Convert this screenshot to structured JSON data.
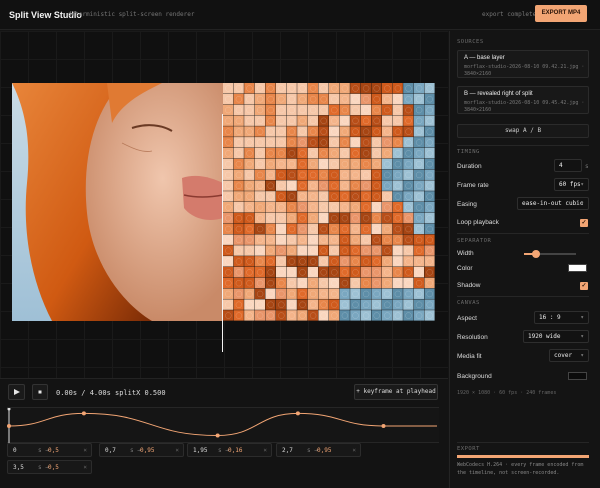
{
  "header": {
    "title": "Split View Studio",
    "subtitle": "deterministic split-screen renderer",
    "status": "export complete",
    "export_label": "EXPORT MP4"
  },
  "stage": {
    "image_description": "Portrait of a woman with orange hair, left half photo, right half pixel blocks"
  },
  "transport": {
    "play_icon": "play-icon",
    "stop_icon": "stop-icon",
    "time_readout": "0.00s / 4.00s splitX 0.500",
    "keyframe_button": "+ keyframe at playhead",
    "keyframes": [
      {
        "time": "0",
        "value": "0,5"
      },
      {
        "time": "0,7",
        "value": "0,95"
      },
      {
        "time": "1,95",
        "value": "0,16"
      },
      {
        "time": "2,7",
        "value": "0,95"
      },
      {
        "time": "3,5",
        "value": "0,5"
      }
    ],
    "keyframe_sep": "s →",
    "remove_glyph": "×"
  },
  "sidebar": {
    "sources_heading": "SOURCES",
    "source_a": {
      "title": "A — base layer",
      "meta": "morflax-studio-2026-08-10 09.42.21.jpg · 3840×2160"
    },
    "source_b": {
      "title": "B — revealed right of split",
      "meta": "morflax-studio-2026-08-10 09.45.42.jpg · 3840×2160"
    },
    "swap_label": "swap A / B",
    "timing_heading": "TIMING",
    "duration_label": "Duration",
    "duration_value": "4",
    "duration_unit": "s",
    "framerate_label": "Frame rate",
    "framerate_value": "60 fps",
    "easing_label": "Easing",
    "easing_value": "ease-in-out cubic",
    "loop_label": "Loop playback",
    "separator_heading": "SEPARATOR",
    "width_label": "Width",
    "width_fraction": 0.23,
    "color_label": "Color",
    "color_value": "#ffffff",
    "shadow_label": "Shadow",
    "canvas_heading": "CANVAS",
    "aspect_label": "Aspect",
    "aspect_value": "16 : 9",
    "resolution_label": "Resolution",
    "resolution_value": "1920 wide",
    "mediafit_label": "Media fit",
    "mediafit_value": "cover",
    "background_label": "Background",
    "background_value": "#0b0b0b",
    "canvas_info": "1920 × 1080 · 60 fps · 240 frames",
    "export_heading": "EXPORT",
    "export_progress": 1.0,
    "export_note": "WebCodecs H.264 · every frame encoded from the timeline, not screen-recorded."
  },
  "colors": {
    "accent": "#f2a574",
    "background": "#141414"
  }
}
